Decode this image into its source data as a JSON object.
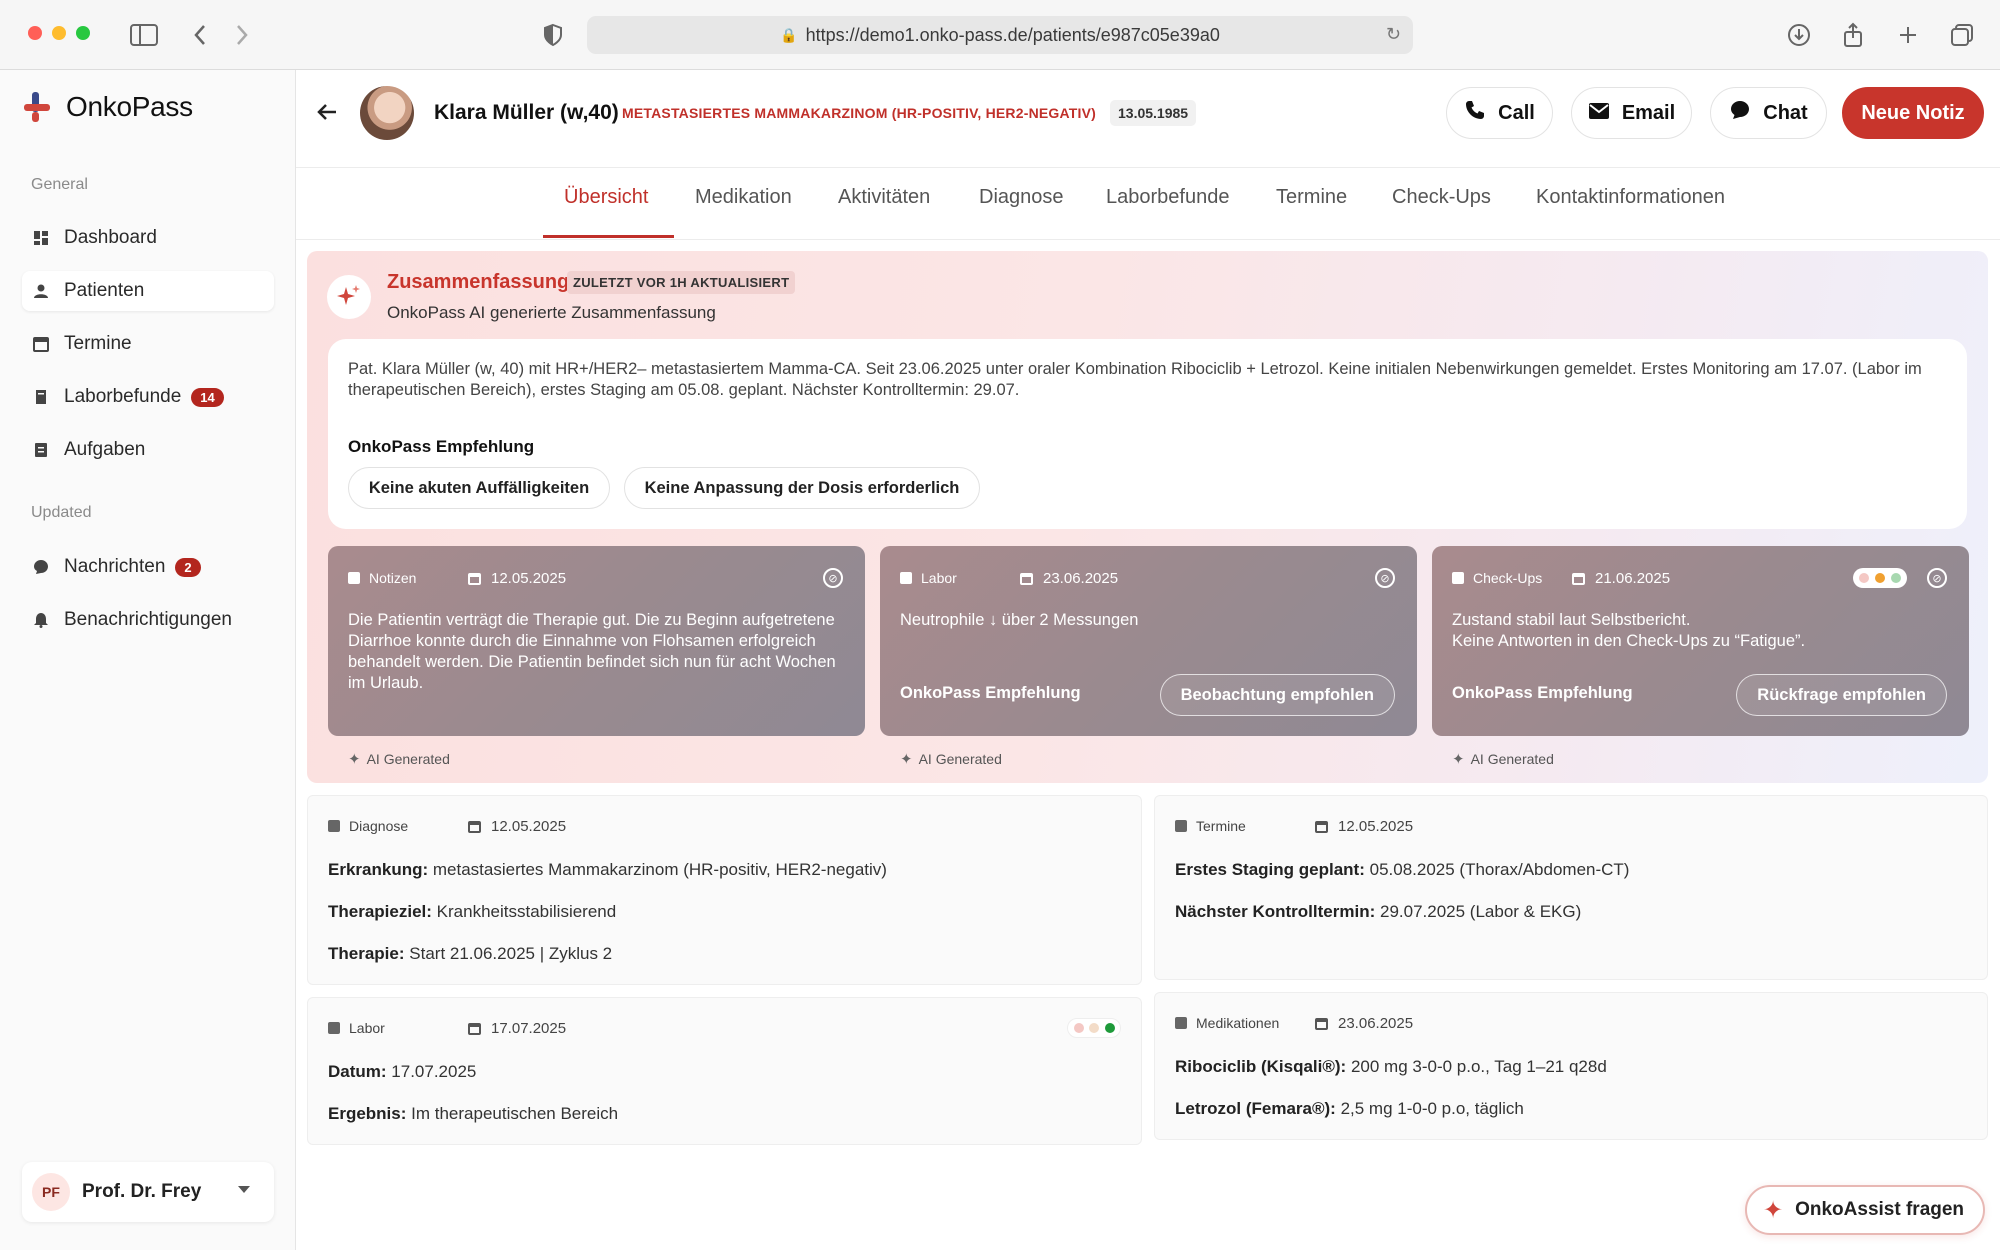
{
  "browser": {
    "url": "https://demo1.onko-pass.de/patients/e987c05e39a0"
  },
  "sidebar": {
    "logo_text": "OnkoPass",
    "section_general": "General",
    "section_updated": "Updated",
    "items": [
      {
        "label": "Dashboard",
        "icon": "dashboard-icon"
      },
      {
        "label": "Patienten",
        "icon": "user-icon",
        "active": true
      },
      {
        "label": "Termine",
        "icon": "calendar-icon"
      },
      {
        "label": "Laborbefunde",
        "icon": "lab-icon",
        "badge": "14"
      },
      {
        "label": "Aufgaben",
        "icon": "tasks-icon"
      }
    ],
    "updated_items": [
      {
        "label": "Nachrichten",
        "icon": "chat-icon",
        "badge": "2"
      },
      {
        "label": "Benachrichtigungen",
        "icon": "bell-icon"
      }
    ],
    "user": {
      "initials": "PF",
      "name": "Prof. Dr. Frey"
    }
  },
  "header": {
    "patient_name": "Klara Müller (w,40)",
    "diagnosis": "METASTASIERTES MAMMAKARZINOM (HR-POSITIV, HER2-NEGATIV)",
    "dob": "13.05.1985",
    "call_label": "Call",
    "email_label": "Email",
    "chat_label": "Chat",
    "new_note_label": "Neue Notiz"
  },
  "tabs": [
    "Übersicht",
    "Medikation",
    "Aktivitäten",
    "Diagnose",
    "Laborbefunde",
    "Termine",
    "Check-Ups",
    "Kontaktinformationen"
  ],
  "summary": {
    "title": "Zusammenfassung",
    "badge": "ZULETZT VOR 1H AKTUALISIERT",
    "subtitle": "OnkoPass AI generierte Zusammenfassung",
    "text": "Pat. Klara Müller (w, 40) mit HR+/HER2– metastasiertem Mamma-CA. Seit 23.06.2025 unter oraler Kombination Ribociclib + Letrozol. Keine initialen Nebenwirkungen gemeldet. Erstes Monitoring am 17.07. (Labor im therapeutischen Bereich), erstes Staging am 05.08. geplant. Nächster Kontrolltermin: 29.07.",
    "rec_label": "OnkoPass Empfehlung",
    "chips": [
      "Keine akuten Auffälligkeiten",
      "Keine Anpassung der Dosis erforderlich"
    ]
  },
  "insights": [
    {
      "type": "Notizen",
      "date": "12.05.2025",
      "body": "Die Patientin verträgt die Therapie gut. Die zu Beginn aufgetretene Diarrhoe konnte durch die Einnahme von Flohsamen erfolgreich behandelt werden. Die Patientin befindet sich nun für acht Wochen im Urlaub.",
      "ai_tag": "AI Generated"
    },
    {
      "type": "Labor",
      "date": "23.06.2025",
      "body": "Neutrophile ↓ über 2 Messungen",
      "rec_label": "OnkoPass Empfehlung",
      "rec_button": "Beobachtung empfohlen",
      "ai_tag": "AI Generated"
    },
    {
      "type": "Check-Ups",
      "date": "21.06.2025",
      "body": "Zustand stabil laut Selbstbericht.\nKeine Antworten in den Check-Ups zu “Fatigue”.",
      "rec_label": "OnkoPass Empfehlung",
      "rec_button": "Rückfrage empfohlen",
      "ai_tag": "AI Generated",
      "status_colors": [
        "#f4c8c4",
        "#f0a030",
        "#a8d8b0"
      ]
    }
  ],
  "cards": {
    "diagnose": {
      "type": "Diagnose",
      "date": "12.05.2025",
      "rows": [
        {
          "label": "Erkrankung:",
          "value": "metastasiertes Mammakarzinom (HR-positiv, HER2-negativ)"
        },
        {
          "label": "Therapieziel:",
          "value": "Krankheitsstabilisierend"
        },
        {
          "label": "Therapie:",
          "value": "Start 21.06.2025 | Zyklus 2"
        }
      ]
    },
    "termine": {
      "type": "Termine",
      "date": "12.05.2025",
      "rows": [
        {
          "label": "Erstes Staging geplant:",
          "value": "05.08.2025 (Thorax/Abdomen-CT)"
        },
        {
          "label": "Nächster Kontrolltermin:",
          "value": "29.07.2025 (Labor & EKG)"
        }
      ]
    },
    "labor": {
      "type": "Labor",
      "date": "17.07.2025",
      "rows": [
        {
          "label": "Datum:",
          "value": "17.07.2025"
        },
        {
          "label": "Ergebnis:",
          "value": "Im therapeutischen Bereich"
        }
      ],
      "status_colors": [
        "#f4c8c4",
        "#f3dcc8",
        "#1e9a3a"
      ]
    },
    "medikationen": {
      "type": "Medikationen",
      "date": "23.06.2025",
      "rows": [
        {
          "label": "Ribociclib (Kisqali®):",
          "value": "200 mg 3-0-0 p.o., Tag 1–21 q28d"
        },
        {
          "label": "Letrozol (Femara®):",
          "value": "2,5 mg 1-0-0 p.o, täglich"
        }
      ]
    }
  },
  "assist_label": "OnkoAssist fragen",
  "colors": {
    "accent": "#c8352c",
    "badge": "#b3261e"
  }
}
